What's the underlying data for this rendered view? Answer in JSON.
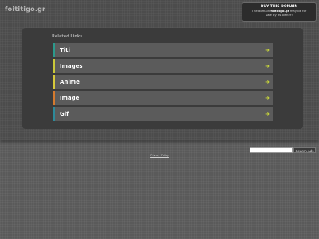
{
  "header": {
    "domain": "foititigo.gr"
  },
  "buy_box": {
    "title": "BUY THIS DOMAIN",
    "text_prefix": "The domain",
    "domain": "foititigo.gr",
    "text_suffix": "may be for sale by its owner!"
  },
  "related": {
    "title": "Related Links",
    "items": [
      {
        "label": "Titi",
        "color": "#2b9a8c"
      },
      {
        "label": "Images",
        "color": "#c9c83a"
      },
      {
        "label": "Anime",
        "color": "#d7c93a"
      },
      {
        "label": "Image",
        "color": "#d47a2e"
      },
      {
        "label": "Gif",
        "color": "#2d8a9a"
      }
    ],
    "arrow_icon": "arrow-right-icon",
    "arrow_color": "#c8d63a"
  },
  "search": {
    "placeholder": "",
    "button_label": "Search Ads"
  },
  "footer": {
    "privacy_label": "Privacy Policy"
  }
}
